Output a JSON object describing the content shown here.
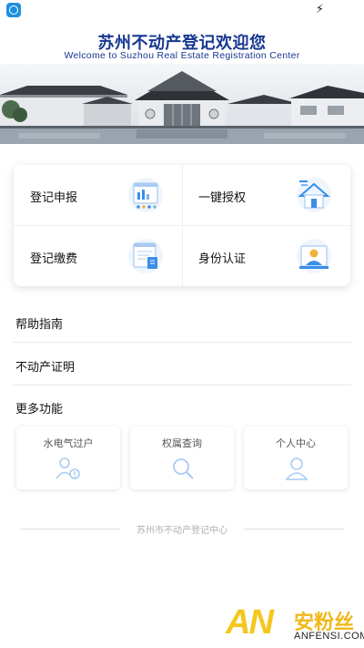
{
  "banner": {
    "title": "苏州不动产登记欢迎您",
    "subtitle": "Welcome to Suzhou Real Estate Registration Center"
  },
  "grid": [
    {
      "label": "登记申报",
      "icon": "form-document-icon"
    },
    {
      "label": "一键授权",
      "icon": "house-key-icon"
    },
    {
      "label": "登记缴费",
      "icon": "payment-receipt-icon"
    },
    {
      "label": "身份认证",
      "icon": "identity-person-icon"
    }
  ],
  "rows": [
    {
      "label": "帮助指南"
    },
    {
      "label": "不动产证明"
    },
    {
      "label": "更多功能"
    }
  ],
  "more": [
    {
      "label": "水电气过户",
      "icon": "user-transfer-icon"
    },
    {
      "label": "权属查询",
      "icon": "search-icon"
    },
    {
      "label": "个人中心",
      "icon": "user-icon"
    }
  ],
  "footer": {
    "text": "苏州市不动产登记中心"
  },
  "watermark": {
    "logo": "AN",
    "name_cn": "安粉丝",
    "name_en": "ANFENSI.COM"
  },
  "colors": {
    "title": "#17378f",
    "accent": "#3a8ee6",
    "icon_light": "#a9cbf2"
  }
}
